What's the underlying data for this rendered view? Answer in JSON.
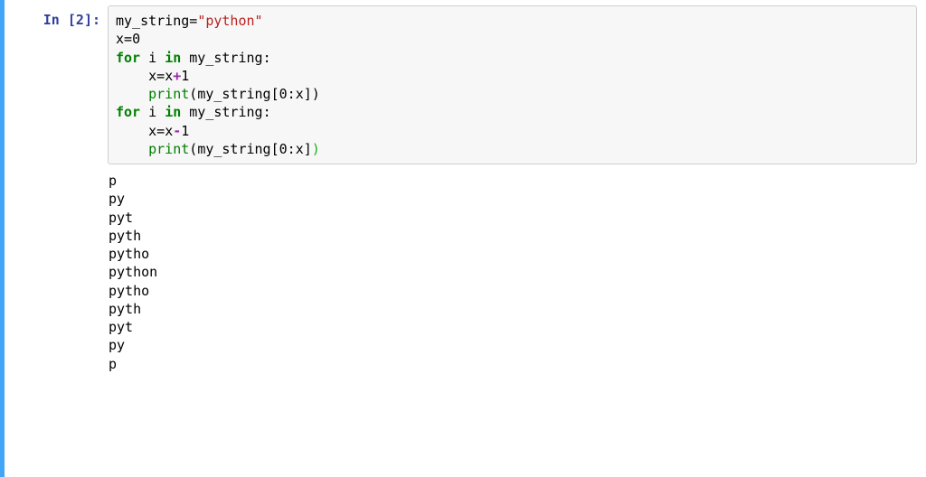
{
  "cell": {
    "prompt_prefix": "In [",
    "prompt_number": "2",
    "prompt_suffix": "]:",
    "code": {
      "l1_var": "my_string",
      "l1_eq": "=",
      "l1_str": "\"python\"",
      "l2_var": "x",
      "l2_eq": "=",
      "l2_num": "0",
      "l3_for": "for",
      "l3_i": " i ",
      "l3_in": "in",
      "l3_ms": " my_string",
      "l3_colon": ":",
      "l4_indent": "    ",
      "l4_x1": "x",
      "l4_eq": "=",
      "l4_x2": "x",
      "l4_plus": "+",
      "l4_one": "1",
      "l5_indent": "    ",
      "l5_print": "print",
      "l5_op": "(",
      "l5_ms": "my_string",
      "l5_br": "[",
      "l5_zero": "0",
      "l5_colon": ":",
      "l5_x": "x",
      "l5_brc": "]",
      "l5_cp": ")",
      "l6_for": "for",
      "l6_i": " i ",
      "l6_in": "in",
      "l6_ms": " my_string",
      "l6_colon": ":",
      "l7_indent": "    ",
      "l7_x1": "x",
      "l7_eq": "=",
      "l7_x2": "x",
      "l7_minus": "-",
      "l7_one": "1",
      "l8_indent": "    ",
      "l8_print": "print",
      "l8_op": "(",
      "l8_ms": "my_string",
      "l8_br": "[",
      "l8_zero": "0",
      "l8_colon": ":",
      "l8_x": "x",
      "l8_brc": "]",
      "l8_cp": ")"
    },
    "output": {
      "lines": [
        "p",
        "py",
        "pyt",
        "pyth",
        "pytho",
        "python",
        "pytho",
        "pyth",
        "pyt",
        "py",
        "p"
      ]
    }
  }
}
